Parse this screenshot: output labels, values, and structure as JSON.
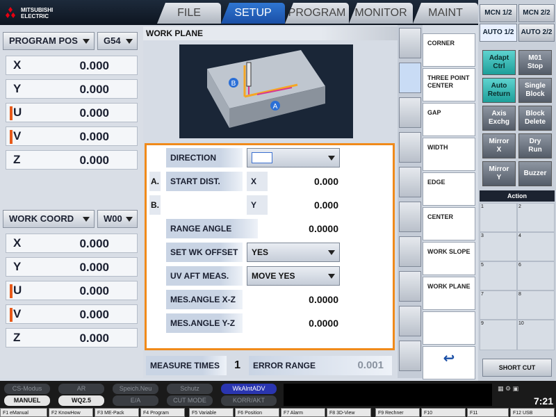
{
  "header": {
    "logo_line1": "MITSUBISHI",
    "logo_line2": "ELECTRIC",
    "tabs": [
      {
        "label": "FILE"
      },
      {
        "label": "SETUP"
      },
      {
        "label": "PROGRAM"
      },
      {
        "label": "MONITOR"
      },
      {
        "label": "MAINT"
      }
    ],
    "active_tab": "SETUP"
  },
  "right_tabs": {
    "row1": [
      "MCN 1/2",
      "MCN 2/2"
    ],
    "row2": [
      "AUTO 1/2",
      "AUTO 2/2"
    ]
  },
  "program_pos": {
    "dropdown": "PROGRAM POS",
    "coord": "G54",
    "axes": [
      {
        "label": "X",
        "value": "0.000"
      },
      {
        "label": "Y",
        "value": "0.000"
      },
      {
        "label": "U",
        "value": "0.000"
      },
      {
        "label": "V",
        "value": "0.000"
      },
      {
        "label": "Z",
        "value": "0.000"
      }
    ]
  },
  "work_coord": {
    "dropdown": "WORK COORD",
    "coord": "W00",
    "axes": [
      {
        "label": "X",
        "value": "0.000"
      },
      {
        "label": "Y",
        "value": "0.000"
      },
      {
        "label": "U",
        "value": "0.000"
      },
      {
        "label": "V",
        "value": "0.000"
      },
      {
        "label": "Z",
        "value": "0.000"
      }
    ]
  },
  "work_plane": {
    "title": "WORK PLANE",
    "diagram_labels": [
      "A",
      "B"
    ],
    "direction_label": "DIRECTION",
    "a_label": "A.",
    "b_label": "B.",
    "start_dist_label": "START DIST.",
    "x_label": "X",
    "x_value": "0.000",
    "y_label": "Y",
    "y_value": "0.000",
    "range_angle_label": "RANGE ANGLE",
    "range_angle_value": "0.0000",
    "set_wk_offset_label": "SET WK OFFSET",
    "set_wk_offset_value": "YES",
    "uv_aft_meas_label": "UV AFT MEAS.",
    "uv_aft_meas_value": "MOVE YES",
    "mes_angle_xz_label": "MES.ANGLE X-Z",
    "mes_angle_xz_value": "0.0000",
    "mes_angle_yz_label": "MES.ANGLE Y-Z",
    "mes_angle_yz_value": "0.0000",
    "measure_times_label": "MEASURE TIMES",
    "measure_times_value": "1",
    "error_range_label": "ERROR RANGE",
    "error_range_value": "0.001"
  },
  "side_menu": [
    "CORNER",
    "THREE POINT CENTER",
    "GAP",
    "WIDTH",
    "EDGE",
    "CENTER",
    "WORK SLOPE",
    "WORK PLANE",
    ""
  ],
  "side_buttons": [
    [
      "Adapt",
      "Ctrl"
    ],
    [
      "M01",
      "Stop"
    ],
    [
      "Auto",
      "Return"
    ],
    [
      "Single",
      "Block"
    ],
    [
      "Axis",
      "Exchg"
    ],
    [
      "Block",
      "Delete"
    ],
    [
      "Mirror",
      "X"
    ],
    [
      "Dry",
      "Run"
    ],
    [
      "Mirror",
      "Y"
    ],
    [
      "Buzzer",
      ""
    ]
  ],
  "action": {
    "title": "Action",
    "cells": [
      "1",
      "2",
      "3",
      "4",
      "5",
      "6",
      "7",
      "8",
      "9",
      "10"
    ],
    "shortcut": "SHORT CUT"
  },
  "status_row1": [
    "CS-Modus",
    "AR",
    "Speich.Neu",
    "Schutz",
    "WkAlntADV"
  ],
  "status_row2": [
    "MANUEL",
    "WQ2.5",
    "E/A",
    "CUT MODE",
    "KORR/AKT"
  ],
  "clock": "7:21",
  "fkeys": [
    "F1 eManual",
    "F2 KnowHow",
    "F3 ME-Pack",
    "F4 Program",
    "F5 Variable",
    "F6 Position",
    "F7 Alarm",
    "F8 3D-View",
    "F9 Rechner",
    "F10",
    "F11",
    "F12 USB"
  ],
  "colors": {
    "accent": "#2f76d2",
    "highlight": "#f08a1a",
    "teal": "#1d9f9a"
  }
}
